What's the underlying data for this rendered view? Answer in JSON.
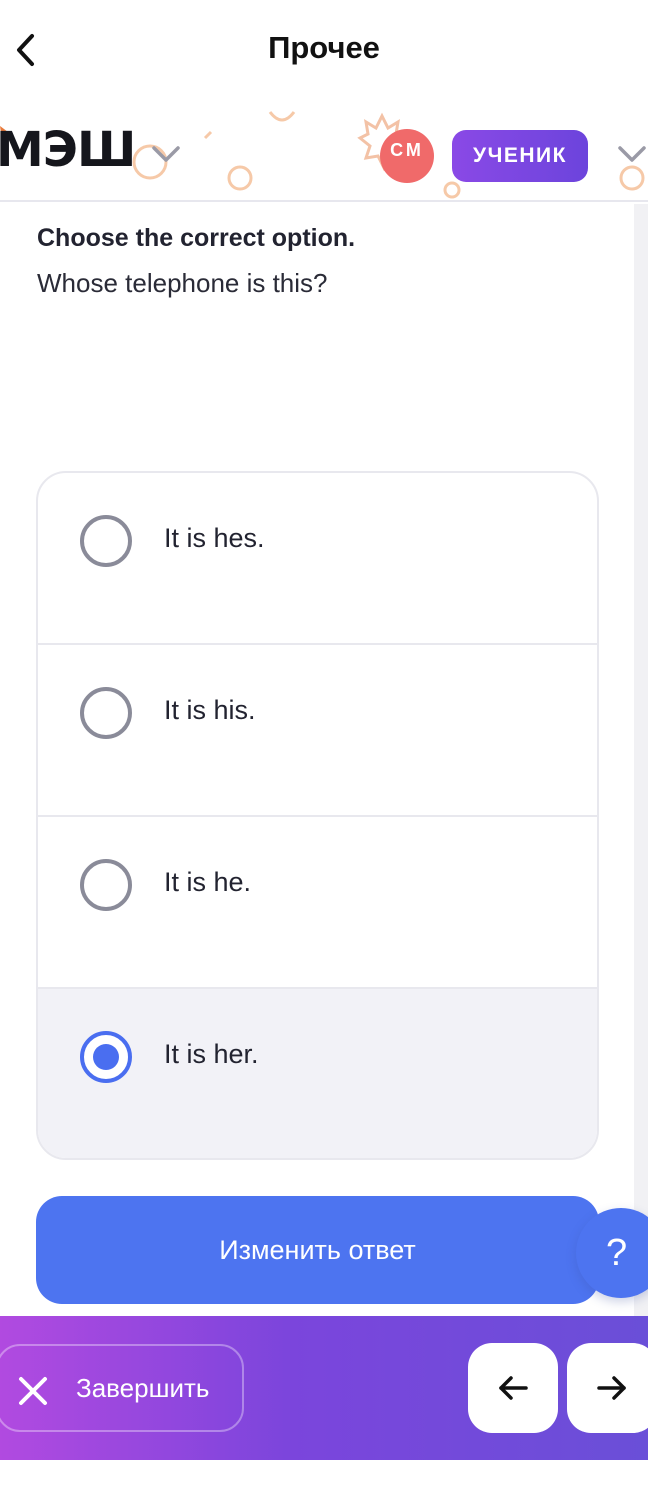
{
  "header": {
    "title": "Прочее"
  },
  "brand": {
    "logo_text": "МЭШ",
    "avatar_initials": "СМ",
    "role_label": "УЧЕНИК"
  },
  "task": {
    "instruction": "Choose the correct option.",
    "question": "Whose telephone is this?",
    "options": [
      {
        "label": "It is hes.",
        "selected": false
      },
      {
        "label": "It is his.",
        "selected": false
      },
      {
        "label": "It is he.",
        "selected": false
      },
      {
        "label": "It is her.",
        "selected": true
      }
    ],
    "change_answer_label": "Изменить ответ",
    "help_label": "?"
  },
  "footer": {
    "finish_label": "Завершить"
  },
  "colors": {
    "accent_blue": "#4d74f0",
    "role_purple": "#7b45dc",
    "avatar_red": "#f06a6a"
  },
  "icons": {
    "back": "chevron-left-icon",
    "logo_menu": "chevron-down-icon",
    "close": "close-icon",
    "prev": "arrow-left-icon",
    "next": "arrow-right-icon"
  }
}
